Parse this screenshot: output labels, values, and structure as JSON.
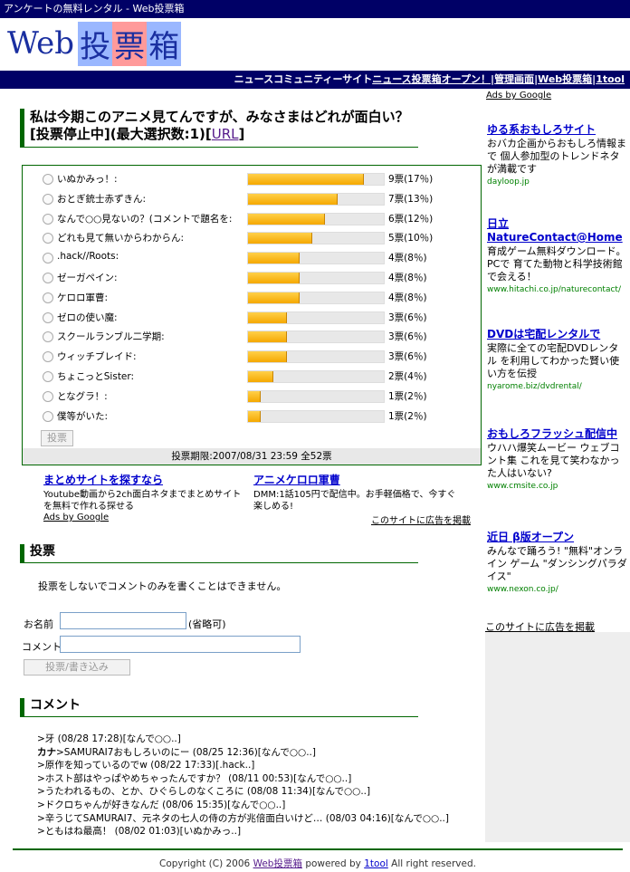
{
  "header": {
    "top_title": "アンケートの無料レンタル - Web投票箱",
    "logo_web": "Web",
    "logo_k1": "投",
    "logo_k2": "票",
    "logo_k3": "箱"
  },
  "nav": {
    "news_prefix": "ニュースコミュニティーサイト",
    "news_link": "ニュース投票箱オープン！",
    "sep": "|",
    "admin": "管理画面",
    "web": "Web投票箱",
    "tool": "1tool"
  },
  "poll": {
    "title": "私は今期このアニメ見てんですが、みなさまはどれが面白い？ [投票停止中](最大選択数:1)[",
    "url_label": "URL",
    "title_end": "]",
    "options": [
      {
        "label": "いぬかみっ！:",
        "votes": 9,
        "count_text": "9票(17％)"
      },
      {
        "label": "おとぎ銃士赤ずきん:",
        "votes": 7,
        "count_text": "7票(13％)"
      },
      {
        "label": "なんで○○見ないの？(コメントで題名を:",
        "votes": 6,
        "count_text": "6票(12％)"
      },
      {
        "label": "どれも見て無いからわからん:",
        "votes": 5,
        "count_text": "5票(10％)"
      },
      {
        "label": ".hack//Roots:",
        "votes": 4,
        "count_text": "4票(8％)"
      },
      {
        "label": "ゼーガペイン:",
        "votes": 4,
        "count_text": "4票(8％)"
      },
      {
        "label": "ケロロ軍曹:",
        "votes": 4,
        "count_text": "4票(8％)"
      },
      {
        "label": "ゼロの使い魔:",
        "votes": 3,
        "count_text": "3票(6％)"
      },
      {
        "label": "スクールランブル二学期:",
        "votes": 3,
        "count_text": "3票(6％)"
      },
      {
        "label": "ウィッチブレイド:",
        "votes": 3,
        "count_text": "3票(6％)"
      },
      {
        "label": "ちょこっとSister:",
        "votes": 2,
        "count_text": "2票(4％)"
      },
      {
        "label": "となグラ！:",
        "votes": 1,
        "count_text": "1票(2％)"
      },
      {
        "label": "僕等がいた:",
        "votes": 1,
        "count_text": "1票(2％)"
      }
    ],
    "max_votes": 9,
    "vote_button": "投票",
    "footer": "投票期限:2007/08/31 23:59 全52票"
  },
  "ads_bottom": {
    "ad1_title": "まとめサイトを探すなら",
    "ad1_text": "Youtube動画から2ch面白ネタまでまとめサイトを無料で作れる探せる",
    "ad2_title": "アニメケロロ軍曹",
    "ad2_text": "DMM:1話105円で配信中。お手軽価格で、今すぐ楽しめる!",
    "ads_by": "Ads by Google",
    "site_ad": "このサイトに広告を掲載"
  },
  "vote_section": {
    "heading": "投票",
    "note": "投票をしないでコメントのみを書くことはできません。",
    "name_label": "お名前",
    "name_hint": "(省略可)",
    "comment_label": "コメント",
    "submit": "投票/書き込み"
  },
  "comment_section": {
    "heading": "コメント",
    "items": [
      {
        "name": "",
        "text": ">牙 (08/28 17:28)[なんで○○..]"
      },
      {
        "name": "カナ",
        "text": ">SAMURAI7おもしろいのにー (08/25 12:36)[なんで○○..]"
      },
      {
        "name": "",
        "text": ">原作を知っているのでw (08/22 17:33)[.hack..]"
      },
      {
        "name": "",
        "text": ">ホスト部はやっぱやめちゃったんですか？ (08/11 00:53)[なんで○○..]"
      },
      {
        "name": "",
        "text": ">うたわれるもの、とか、ひぐらしのなくころに (08/08 11:34)[なんで○○..]"
      },
      {
        "name": "",
        "text": ">ドクロちゃんが好きなんだ (08/06 15:35)[なんで○○..]"
      },
      {
        "name": "",
        "text": ">辛うじてSAMURAI7、元ネタの七人の侍の方が兆倍面白いけど… (08/03 04:16)[なんで○○..]"
      },
      {
        "name": "",
        "text": ">ともはね最高！ (08/02 01:03)[いぬかみっ..]"
      }
    ]
  },
  "sidebar": {
    "ads_by": "Ads by Google",
    "ads": [
      {
        "title": "ゆる系おもしろサイト",
        "text": "おバカ企画からおもしろ情報まで 個人参加型のトレンドネタが満載です",
        "url": "dayloop.jp"
      },
      {
        "title": "日立 NatureContact@Home",
        "text": "育成ゲーム無料ダウンロード。PCで 育てた動物と科学技術館で会える！",
        "url": "www.hitachi.co.jp/naturecontact/"
      },
      {
        "title": "DVDは宅配レンタルで",
        "text": "実際に全ての宅配DVDレンタル を利用してわかった賢い使い方を伝授",
        "url": "nyarome.biz/dvdrental/"
      },
      {
        "title": "おもしろフラッシュ配信中",
        "text": "ウハハ爆笑ムービー ウェブコント集 これを見て笑わなかった人はいない?",
        "url": "www.cmsite.co.jp"
      },
      {
        "title": "近日 β版オープン",
        "text": "みんなで踊ろう! \"無料\"オンライン ゲーム \"ダンシングパラダイス\"",
        "url": "www.nexon.co.jp/"
      }
    ],
    "site_ad": "このサイトに広告を掲載"
  },
  "footer": {
    "prefix": "Copyright (C) 2006 ",
    "link1": "Web投票箱",
    "middle": " powered by ",
    "link2": "1tool",
    "suffix": " All right reserved."
  }
}
